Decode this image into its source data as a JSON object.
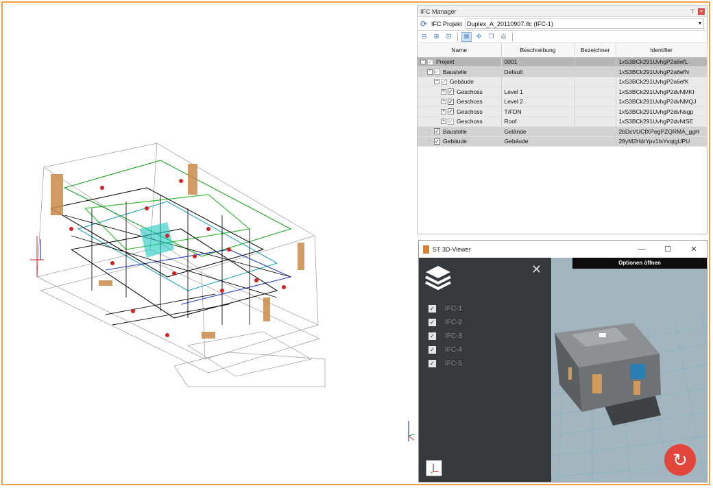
{
  "ifc_manager": {
    "title": "IFC Manager",
    "project_label": "IFC Projekt",
    "project_value": "Duplex_A_20110907.ifc (IFC-1)",
    "columns": [
      "Name",
      "Beschreibung",
      "Bezeichner",
      "Identifier"
    ],
    "rows": [
      {
        "name": "Projekt",
        "beschreibung": "0001",
        "bezeichner": "",
        "identifier": "1xS3BCk291UvhgP2a6efL"
      },
      {
        "name": "Baustelle",
        "beschreibung": "Default",
        "bezeichner": "",
        "identifier": "1xS3BCk291UvhgP2a6efN"
      },
      {
        "name": "Gebäude",
        "beschreibung": "",
        "bezeichner": "",
        "identifier": "1xS3BCk291UvhgP2a6efK"
      },
      {
        "name": "Geschoss",
        "beschreibung": "Level 1",
        "bezeichner": "",
        "identifier": "1xS3BCk291UvhgP2dvNMKI"
      },
      {
        "name": "Geschoss",
        "beschreibung": "Level 2",
        "bezeichner": "",
        "identifier": "1xS3BCk291UvhgP2dvNMQJ"
      },
      {
        "name": "Geschoss",
        "beschreibung": "T/FDN",
        "bezeichner": "",
        "identifier": "1xS3BCk291UvhgP2dvNsgp"
      },
      {
        "name": "Geschoss",
        "beschreibung": "Roof",
        "bezeichner": "",
        "identifier": "1xS3BCk291UvhgP2dvNtSE"
      },
      {
        "name": "Baustelle",
        "beschreibung": "Gelände",
        "bezeichner": "",
        "identifier": "2bDcVUCfXPegPZQRMA_ggH"
      },
      {
        "name": "Gebäude",
        "beschreibung": "Gebäude",
        "bezeichner": "",
        "identifier": "28yM2HdrYpv1tsYvqtgUPU"
      }
    ]
  },
  "viewer": {
    "title": "ST 3D-Viewer",
    "options_button": "Optionen öffnen",
    "layers": [
      "IFC-1",
      "IFC-2",
      "IFC-3",
      "IFC-4",
      "IFC-5"
    ],
    "minimize": "—",
    "maximize": "☐",
    "close": "✕",
    "panel_close": "✕",
    "reload_icon": "↻"
  },
  "colors": {
    "frame": "#f0a049",
    "panel_bg": "#35393b",
    "scene_bg": "#a3b6bf",
    "fab": "#e2463b"
  }
}
